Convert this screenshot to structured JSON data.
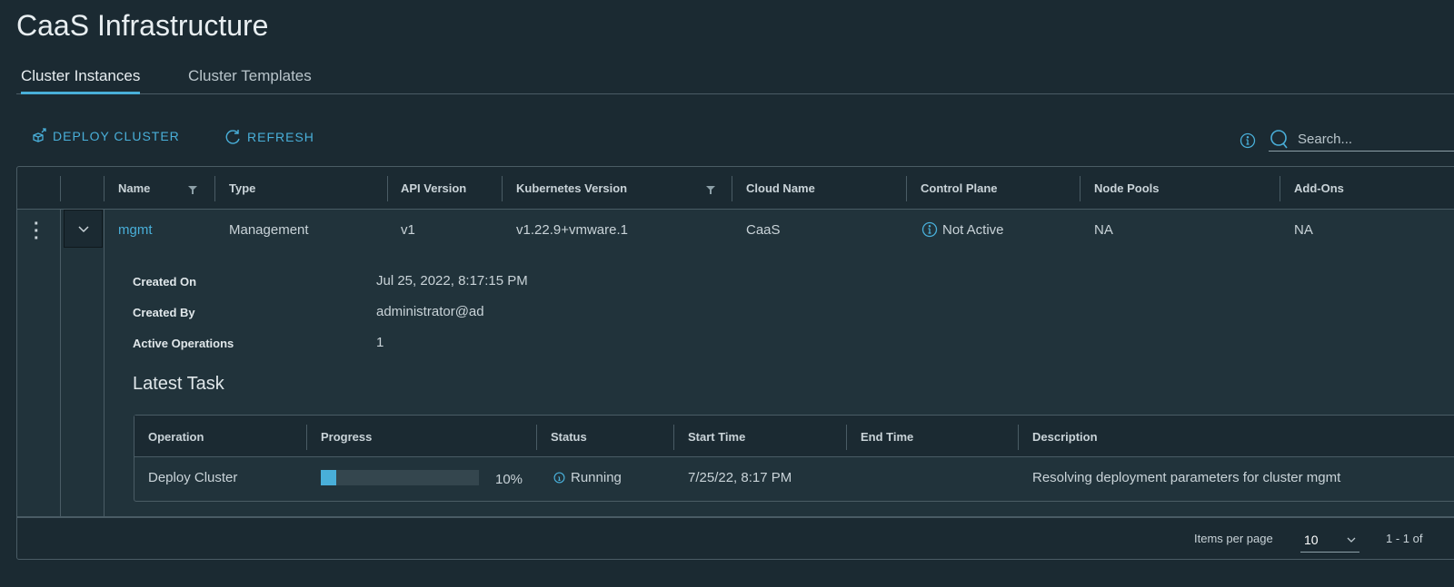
{
  "page": {
    "title": "CaaS Infrastructure"
  },
  "tabs": [
    {
      "label": "Cluster Instances",
      "active": true
    },
    {
      "label": "Cluster Templates",
      "active": false
    }
  ],
  "toolbar": {
    "deploy_label": "DEPLOY CLUSTER",
    "refresh_label": "REFRESH",
    "search_placeholder": "Search..."
  },
  "colors": {
    "accent": "#49afd9",
    "background": "#1b2a32"
  },
  "grid": {
    "columns": [
      "Name",
      "Type",
      "API Version",
      "Kubernetes Version",
      "Cloud Name",
      "Control Plane",
      "Node Pools",
      "Add-Ons"
    ],
    "row": {
      "name": "mgmt",
      "type": "Management",
      "api_version": "v1",
      "kubernetes_version": "v1.22.9+vmware.1",
      "cloud_name": "CaaS",
      "control_plane": "Not Active",
      "node_pools": "NA",
      "add_ons": "NA"
    },
    "details": {
      "created_on_label": "Created On",
      "created_on": "Jul 25, 2022, 8:17:15 PM",
      "created_by_label": "Created By",
      "created_by": "administrator@ad",
      "active_ops_label": "Active Operations",
      "active_ops": "1",
      "latest_task_title": "Latest Task",
      "task_columns": [
        "Operation",
        "Progress",
        "Status",
        "Start Time",
        "End Time",
        "Description"
      ],
      "task": {
        "operation": "Deploy Cluster",
        "progress": 10,
        "progress_text": "10%",
        "status": "Running",
        "start_time": "7/25/22, 8:17 PM",
        "end_time": "",
        "description": "Resolving deployment parameters for cluster mgmt"
      }
    },
    "footer": {
      "items_per_page_label": "Items per page",
      "items_per_page": "10",
      "range": "1 - 1 of"
    }
  }
}
